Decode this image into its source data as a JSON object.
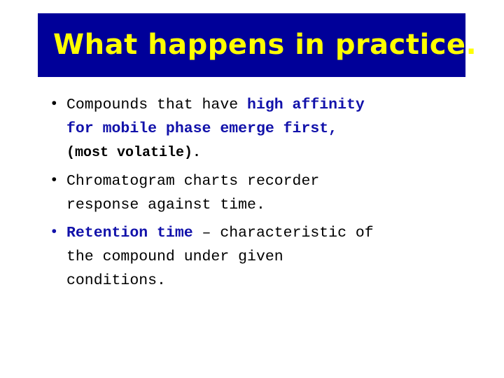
{
  "slide": {
    "title": "What happens in practice.",
    "title_color": "#ffff00",
    "banner_color": "#000099",
    "background_color": "#ffffff",
    "emphasis_color": "#1111aa",
    "body_color": "#000000",
    "bullet_glyph": "•"
  },
  "bullets": [
    {
      "marker_color": "black",
      "lines": [
        [
          {
            "text": "Compounds that have ",
            "style": "normal"
          },
          {
            "text": "high affinity",
            "style": "bold-blue"
          }
        ],
        [
          {
            "text": "for mobile phase emerge first,",
            "style": "bold-blue"
          }
        ],
        [
          {
            "text": "(most volatile).",
            "style": "bold-black"
          }
        ]
      ]
    },
    {
      "marker_color": "black",
      "lines": [
        [
          {
            "text": "Chromatogram charts recorder",
            "style": "normal"
          }
        ],
        [
          {
            "text": "response against time.",
            "style": "normal"
          }
        ]
      ]
    },
    {
      "marker_color": "blue",
      "lines": [
        [
          {
            "text": "Retention time",
            "style": "bold-blue"
          },
          {
            "text": " – characteristic of",
            "style": "normal"
          }
        ],
        [
          {
            "text": "the compound under given",
            "style": "normal"
          }
        ],
        [
          {
            "text": "conditions.",
            "style": "normal"
          }
        ]
      ]
    }
  ]
}
